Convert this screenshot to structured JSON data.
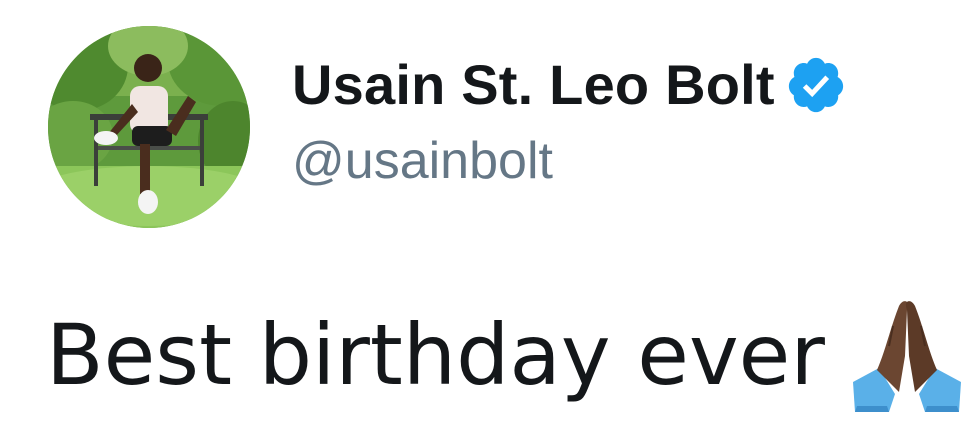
{
  "tweet": {
    "author": {
      "display_name": "Usain St. Leo Bolt",
      "handle": "@usainbolt",
      "verified": true,
      "verified_icon": "verified-badge-icon",
      "avatar_icon": "profile-photo"
    },
    "text": "Best birthday ever",
    "emoji": "folded-hands-icon"
  },
  "colors": {
    "text": "#14171a",
    "handle": "#657786",
    "verified": "#1da1f2",
    "background": "#ffffff"
  }
}
